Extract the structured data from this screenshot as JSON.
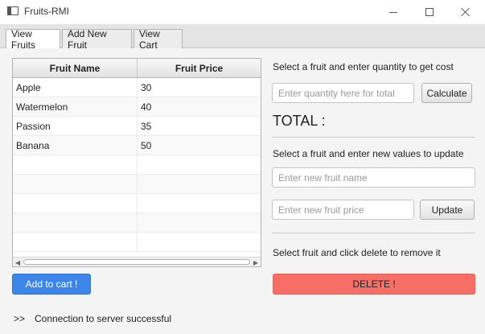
{
  "window": {
    "title": "Fruits-RMI"
  },
  "tabs": [
    {
      "label": "View Fruits",
      "active": true
    },
    {
      "label": "Add New Fruit",
      "active": false
    },
    {
      "label": "View Cart",
      "active": false
    }
  ],
  "table": {
    "columns": [
      "Fruit Name",
      "Fruit Price"
    ],
    "rows": [
      [
        "Apple",
        "30"
      ],
      [
        "Watermelon",
        "40"
      ],
      [
        "Passion",
        "35"
      ],
      [
        "Banana",
        "50"
      ],
      [
        "",
        ""
      ],
      [
        "",
        ""
      ],
      [
        "",
        ""
      ],
      [
        "",
        ""
      ],
      [
        "",
        ""
      ]
    ]
  },
  "cart_button_label": "Add to cart !",
  "status": {
    "prefix": ">>",
    "message": "Connection to server successful"
  },
  "cost_section": {
    "instruction": "Select a fruit and enter quantity to get cost",
    "quantity_placeholder": "Enter quantity here for total",
    "calculate_label": "Calculate",
    "total_label": "TOTAL :"
  },
  "update_section": {
    "instruction": "Select a fruit and enter new values to update",
    "name_placeholder": "Enter new fruit name",
    "price_placeholder": "Enter new fruit price",
    "update_label": "Update"
  },
  "delete_section": {
    "instruction": "Select fruit and click delete to remove it",
    "delete_label": "DELETE !"
  },
  "colors": {
    "cart_button": "#3c86ea",
    "delete_button": "#f66e66"
  }
}
